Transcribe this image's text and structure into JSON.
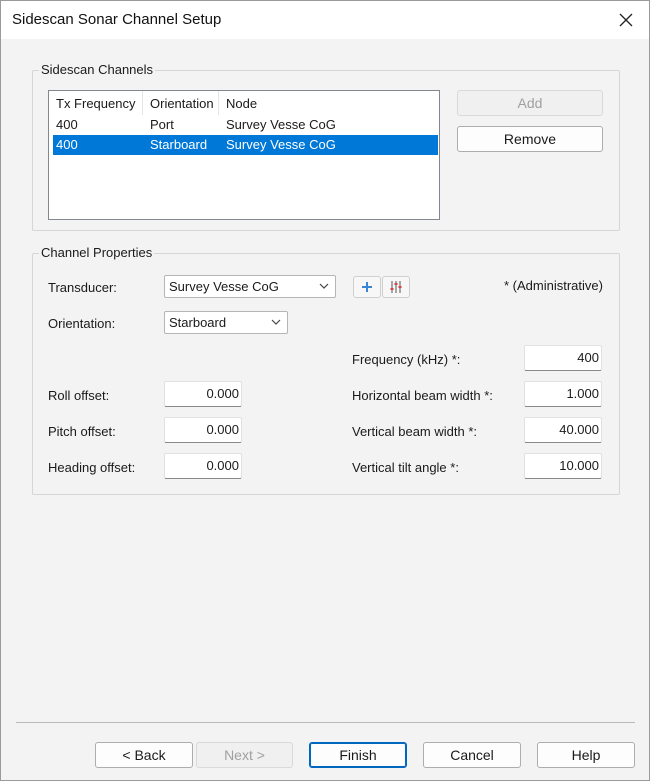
{
  "window": {
    "title": "Sidescan Sonar Channel Setup"
  },
  "channels": {
    "group_title": "Sidescan Channels",
    "columns": [
      "Tx Frequency",
      "Orientation",
      "Node"
    ],
    "rows": [
      {
        "freq": "400",
        "orientation": "Port",
        "node": "Survey Vesse CoG",
        "selected": false
      },
      {
        "freq": "400",
        "orientation": "Starboard",
        "node": "Survey Vesse CoG",
        "selected": true
      }
    ],
    "add_label": "Add",
    "remove_label": "Remove"
  },
  "properties": {
    "group_title": "Channel Properties",
    "transducer_label": "Transducer:",
    "transducer_value": "Survey Vesse CoG",
    "orientation_label": "Orientation:",
    "orientation_value": "Starboard",
    "admin_note": "* (Administrative)",
    "roll_label": "Roll offset:",
    "roll_value": "0.000",
    "pitch_label": "Pitch offset:",
    "pitch_value": "0.000",
    "heading_label": "Heading offset:",
    "heading_value": "0.000",
    "frequency_label": "Frequency (kHz) *:",
    "frequency_value": "400",
    "hbw_label": "Horizontal beam width *:",
    "hbw_value": "1.000",
    "vbw_label": "Vertical beam width *:",
    "vbw_value": "40.000",
    "tilt_label": "Vertical tilt angle *:",
    "tilt_value": "10.000"
  },
  "footer": {
    "back_label": "< Back",
    "next_label": "Next >",
    "finish_label": "Finish",
    "cancel_label": "Cancel",
    "help_label": "Help"
  },
  "colors": {
    "selection": "#0078d7",
    "accent": "#0067c0"
  }
}
